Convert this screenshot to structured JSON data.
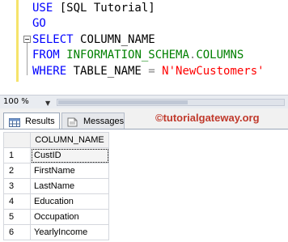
{
  "editor": {
    "lines": [
      [
        {
          "t": "USE ",
          "c": "kw"
        },
        {
          "t": "[SQL Tutorial]",
          "c": "plain"
        }
      ],
      [
        {
          "t": "GO",
          "c": "kw"
        }
      ],
      [
        {
          "t": "SELECT ",
          "c": "kw"
        },
        {
          "t": "COLUMN_NAME",
          "c": "plain"
        }
      ],
      [
        {
          "t": "FROM ",
          "c": "kw"
        },
        {
          "t": "INFORMATION_SCHEMA",
          "c": "obj"
        },
        {
          "t": ".",
          "c": "op"
        },
        {
          "t": "COLUMNS",
          "c": "obj"
        }
      ],
      [
        {
          "t": "WHERE ",
          "c": "kw"
        },
        {
          "t": "TABLE_NAME ",
          "c": "plain"
        },
        {
          "t": "= ",
          "c": "op"
        },
        {
          "t": "N'NewCustomers'",
          "c": "str"
        }
      ]
    ]
  },
  "zoom": {
    "value": "100 %"
  },
  "tabs": {
    "results": "Results",
    "messages": "Messages"
  },
  "brand": "©tutorialgateway.org",
  "grid": {
    "header": "COLUMN_NAME",
    "rows": [
      {
        "num": "1",
        "value": "CustID"
      },
      {
        "num": "2",
        "value": "FirstName"
      },
      {
        "num": "3",
        "value": "LastName"
      },
      {
        "num": "4",
        "value": "Education"
      },
      {
        "num": "5",
        "value": "Occupation"
      },
      {
        "num": "6",
        "value": "YearlyIncome"
      }
    ]
  },
  "icons": {
    "results": "grid-icon",
    "messages": "messages-icon"
  },
  "colors": {
    "keyword": "#0000ff",
    "object": "#008000",
    "string": "#ff0000",
    "brand": "#c0392b"
  }
}
